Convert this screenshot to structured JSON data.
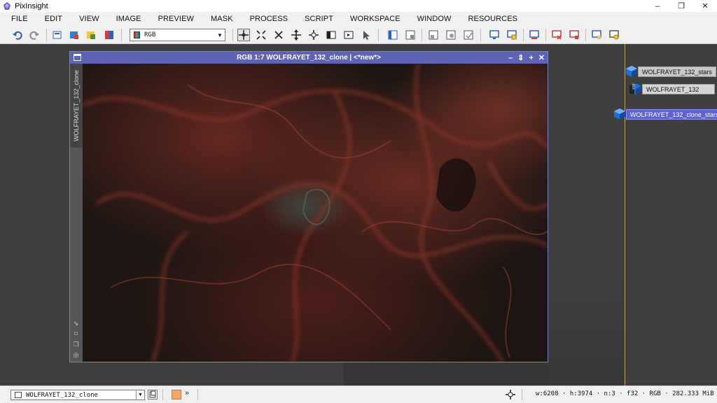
{
  "app": {
    "title": "PixInsight",
    "window_controls": [
      "–",
      "❐",
      "✕"
    ]
  },
  "menu": [
    "FILE",
    "EDIT",
    "VIEW",
    "IMAGE",
    "PREVIEW",
    "MASK",
    "PROCESS",
    "SCRIPT",
    "WORKSPACE",
    "WINDOW",
    "RESOURCES"
  ],
  "toolbar": {
    "color_space": "RGB",
    "select_arrow": "▼"
  },
  "image_window": {
    "title": "RGB 1:7 WOLFRAYET_132_clone | <*new*>",
    "side_tab": "WOLFRAYET_132_clone",
    "buttons": [
      "–",
      "⇕",
      "+",
      "✕"
    ]
  },
  "workspace_views": [
    {
      "label": "WOLFRAYET_132_stars",
      "icon": "cube-icon"
    },
    {
      "label": "WOLFRAYET_132",
      "icon": "xisf-file-icon",
      "badge": "XISF"
    },
    {
      "label": "WOLFRAYET_132_clone_stars",
      "icon": "cube-icon",
      "selected": true
    }
  ],
  "statusbar": {
    "view": "WOLFRAYET_132_clone",
    "more": "»",
    "info": "w:6208 · h:3974 · n:3 · f32 · RGB · 282.333 MiB ·"
  },
  "colors": {
    "window_frame": "#5f63b5",
    "selected_view": "#5b61d6",
    "guide_line": "#c8a35a",
    "nebula_red": "#8a3428"
  }
}
